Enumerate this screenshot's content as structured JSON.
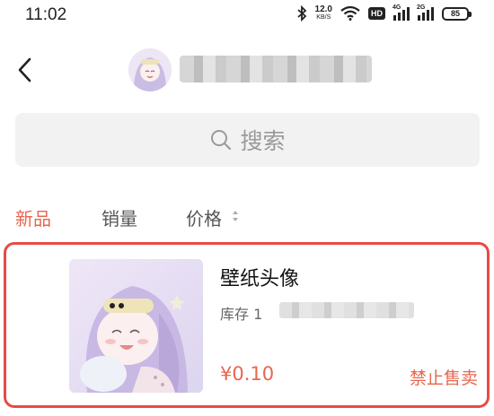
{
  "status_bar": {
    "time": "11:02",
    "net_speed_value": "12.0",
    "net_speed_unit": "KB/S",
    "hd_badge": "HD",
    "signal1_tag": "4G",
    "signal2_tag": "2G",
    "battery_level": "85"
  },
  "header": {
    "back_icon": "chevron-left-icon",
    "shop_name_redacted": true
  },
  "search": {
    "placeholder": "搜索",
    "icon": "search-icon"
  },
  "tabs": {
    "new": "新品",
    "sales": "销量",
    "price": "价格",
    "active": "new"
  },
  "product": {
    "title": "壁纸头像",
    "stock_label": "库存 1",
    "price": "¥0.10",
    "action": "禁止售卖"
  },
  "colors": {
    "accent": "#e8664e",
    "highlight_border": "#e84a45",
    "search_bg": "#f2f2f2"
  }
}
